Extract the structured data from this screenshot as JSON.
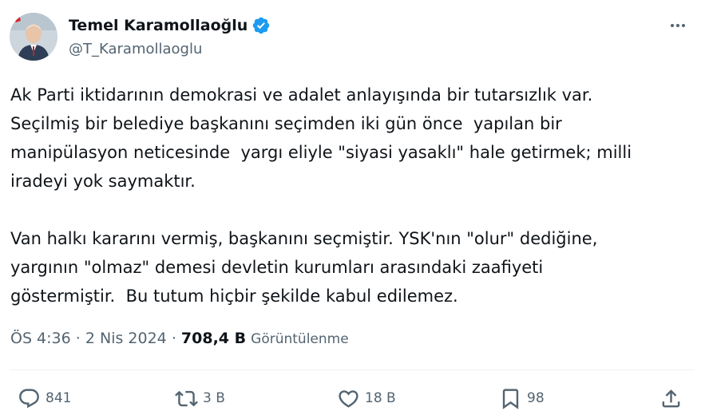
{
  "author": {
    "name": "Temel Karamollaoğlu",
    "handle": "@T_Karamollaoglu",
    "verified": true
  },
  "tweet": {
    "text": "Ak Parti iktidarının demokrasi ve adalet anlayışında bir tutarsızlık var.\nSeçilmiş bir belediye başkanını seçimden iki gün önce  yapılan bir\nmanipülasyon neticesinde  yargı eliyle \"siyasi yasaklı\" hale getirmek; milli\niradeyi yok saymaktır.\n\nVan halkı kararını vermiş, başkanını seçmiştir. YSK'nın \"olur\" dediğine,\nyargının \"olmaz\" demesi devletin kurumları arasındaki zaafiyeti\ngöstermiştir.  Bu tutum hiçbir şekilde kabul edilemez."
  },
  "meta": {
    "time": "ÖS 4:36",
    "sep1": " · ",
    "date": "2 Nis 2024",
    "sep2": " · ",
    "views": "708,4 B",
    "views_label": "Görüntülenme"
  },
  "actions": {
    "replies": "841",
    "reposts": "3 B",
    "likes": "18 B",
    "bookmarks": "98"
  },
  "icons": [
    "more-icon",
    "verified-badge-icon",
    "reply-icon",
    "repost-icon",
    "like-icon",
    "bookmark-icon",
    "share-icon"
  ],
  "colors": {
    "verified": "#1d9bf0",
    "secondary_text": "#536471",
    "primary_text": "#0f1419"
  }
}
